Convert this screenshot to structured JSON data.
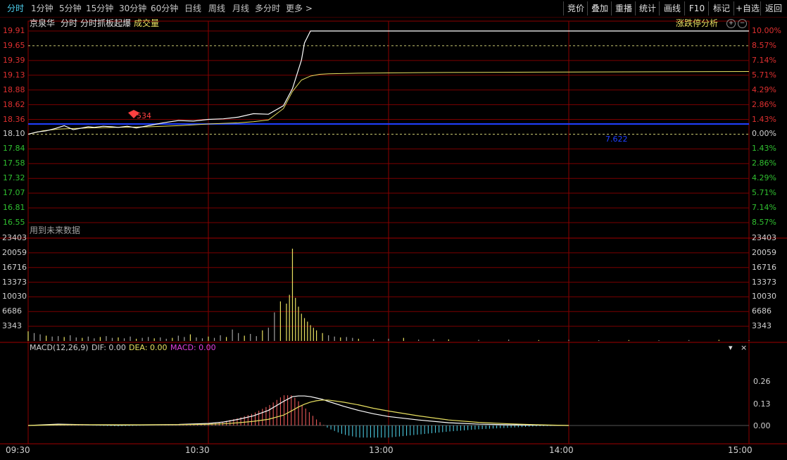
{
  "top_tabs": [
    "分时",
    "1分钟",
    "5分钟",
    "15分钟",
    "30分钟",
    "60分钟",
    "日线",
    "周线",
    "月线",
    "多分时",
    "更多 >"
  ],
  "active_tab": 0,
  "tools": [
    "竞价",
    "叠加",
    "重播",
    "统计",
    "画线",
    "F10",
    "标记",
    "+自选",
    "返回"
  ],
  "stock": {
    "name": "京泉华",
    "view_label": "分时",
    "indicator_label": "分时抓板起爆",
    "volume_label": "成交量",
    "analysis_label": "涨跌停分析",
    "future_data_label": "用到未来数据",
    "marker_value": "534",
    "blue_line_value": "7.622"
  },
  "price_axis": {
    "labels": [
      "19.91",
      "19.65",
      "19.39",
      "19.13",
      "18.88",
      "18.62",
      "18.36",
      "18.10",
      "17.84",
      "17.58",
      "17.32",
      "17.07",
      "16.81",
      "16.55"
    ],
    "pct_labels": [
      "10.00%",
      "8.57%",
      "7.14%",
      "5.71%",
      "4.29%",
      "2.86%",
      "1.43%",
      "0.00%",
      "1.43%",
      "2.86%",
      "4.29%",
      "5.71%",
      "7.14%",
      "8.57%"
    ],
    "prev_close": 18.1,
    "limit_up": 19.91
  },
  "volume_axis": {
    "labels": [
      "23403",
      "20059",
      "16716",
      "13373",
      "10030",
      "6686",
      "3343"
    ],
    "max": 23403
  },
  "macd": {
    "label": "MACD(12,26,9)",
    "dif_label": "DIF: 0.00",
    "dea_label": "DEA: 0.00",
    "macd_label": "MACD: 0.00",
    "axis_labels": [
      "0.26",
      "0.13",
      "0.00"
    ]
  },
  "time_axis": [
    "09:30",
    "10:30",
    "13:00",
    "14:00",
    "15:00"
  ],
  "chart_data": {
    "type": "line",
    "title": "京泉华 分时",
    "x_unit": "minutes since 09:30 (trading minutes)",
    "price_series": {
      "name": "价格",
      "x": [
        0,
        3,
        6,
        9,
        12,
        15,
        18,
        20,
        22,
        25,
        28,
        30,
        33,
        36,
        40,
        45,
        50,
        55,
        60,
        65,
        70,
        75,
        80,
        85,
        88,
        91,
        92,
        94,
        96,
        100,
        105,
        110,
        115,
        120,
        125,
        130,
        135,
        140,
        145,
        150,
        155,
        160,
        165,
        170,
        175,
        180,
        185,
        190,
        195,
        200,
        205,
        210,
        215,
        220,
        225,
        230,
        235,
        240
      ],
      "y": [
        18.1,
        18.14,
        18.16,
        18.2,
        18.25,
        18.18,
        18.21,
        18.23,
        18.22,
        18.24,
        18.23,
        18.22,
        18.24,
        18.21,
        18.25,
        18.3,
        18.34,
        18.33,
        18.36,
        18.37,
        18.4,
        18.46,
        18.45,
        18.6,
        18.9,
        19.4,
        19.7,
        19.91,
        19.91,
        19.91,
        19.91,
        19.91,
        19.91,
        19.91,
        19.91,
        19.91,
        19.91,
        19.91,
        19.91,
        19.91,
        19.91,
        19.91,
        19.91,
        19.91,
        19.91,
        19.91,
        19.91,
        19.91,
        19.91,
        19.91,
        19.91,
        19.91,
        19.91,
        19.91,
        19.91,
        19.91,
        19.91,
        19.91
      ]
    },
    "avg_series": {
      "name": "均价",
      "x": [
        0,
        5,
        10,
        20,
        30,
        40,
        50,
        60,
        65,
        70,
        75,
        80,
        85,
        88,
        91,
        94,
        97,
        100,
        110,
        120,
        130,
        150,
        180,
        210,
        240
      ],
      "y": [
        18.1,
        18.16,
        18.19,
        18.21,
        18.22,
        18.23,
        18.25,
        18.28,
        18.29,
        18.3,
        18.32,
        18.35,
        18.55,
        18.85,
        19.05,
        19.12,
        19.15,
        19.16,
        19.17,
        19.175,
        19.18,
        19.185,
        19.19,
        19.195,
        19.2
      ]
    },
    "volume": {
      "x": [
        0,
        2,
        4,
        6,
        8,
        10,
        12,
        14,
        16,
        18,
        20,
        22,
        24,
        26,
        28,
        30,
        32,
        34,
        36,
        38,
        40,
        42,
        44,
        46,
        48,
        50,
        52,
        54,
        56,
        58,
        60,
        62,
        64,
        66,
        68,
        70,
        72,
        74,
        76,
        78,
        80,
        82,
        84,
        86,
        87,
        88,
        89,
        90,
        91,
        92,
        93,
        94,
        95,
        96,
        98,
        100,
        102,
        104,
        106,
        108,
        110,
        115,
        120,
        125,
        130,
        135,
        140,
        150,
        160,
        170,
        180,
        190,
        200,
        210,
        220,
        230,
        240
      ],
      "y": [
        2200,
        1800,
        1500,
        1200,
        1000,
        1100,
        900,
        1300,
        800,
        700,
        1000,
        600,
        900,
        1100,
        700,
        800,
        600,
        1000,
        500,
        700,
        900,
        600,
        800,
        500,
        700,
        1200,
        900,
        1500,
        800,
        600,
        1000,
        700,
        1300,
        900,
        2600,
        1800,
        1200,
        1600,
        1100,
        2400,
        3000,
        6500,
        9000,
        8500,
        10500,
        21000,
        9800,
        7800,
        6200,
        5200,
        4400,
        3600,
        3000,
        2400,
        1800,
        1300,
        1000,
        800,
        900,
        700,
        500,
        400,
        500,
        700,
        300,
        400,
        350,
        250,
        300,
        200,
        250,
        150,
        200,
        150,
        200,
        250,
        150
      ]
    },
    "macd_series": {
      "x": [
        0,
        10,
        20,
        30,
        40,
        50,
        60,
        65,
        70,
        75,
        80,
        85,
        88,
        90,
        92,
        94,
        96,
        98,
        100,
        105,
        110,
        115,
        120,
        130,
        140,
        150,
        160,
        170,
        180
      ],
      "dif": [
        0.0,
        0.02,
        0.01,
        0.005,
        0.01,
        0.015,
        0.03,
        0.05,
        0.09,
        0.14,
        0.22,
        0.35,
        0.42,
        0.43,
        0.43,
        0.42,
        0.4,
        0.38,
        0.35,
        0.28,
        0.22,
        0.17,
        0.13,
        0.08,
        0.04,
        0.02,
        0.01,
        0.005,
        0.0
      ],
      "dea": [
        0.0,
        0.01,
        0.012,
        0.01,
        0.01,
        0.012,
        0.018,
        0.025,
        0.04,
        0.06,
        0.09,
        0.15,
        0.22,
        0.27,
        0.31,
        0.34,
        0.36,
        0.37,
        0.37,
        0.34,
        0.3,
        0.25,
        0.21,
        0.14,
        0.08,
        0.045,
        0.025,
        0.01,
        0.0
      ],
      "bars": [
        0.0,
        0.02,
        0.0,
        -0.01,
        0.0,
        0.005,
        0.02,
        0.05,
        0.1,
        0.16,
        0.26,
        0.4,
        0.4,
        0.32,
        0.24,
        0.16,
        0.08,
        0.02,
        -0.04,
        -0.12,
        -0.16,
        -0.16,
        -0.16,
        -0.12,
        -0.08,
        -0.05,
        -0.03,
        -0.01,
        0.0
      ]
    }
  }
}
